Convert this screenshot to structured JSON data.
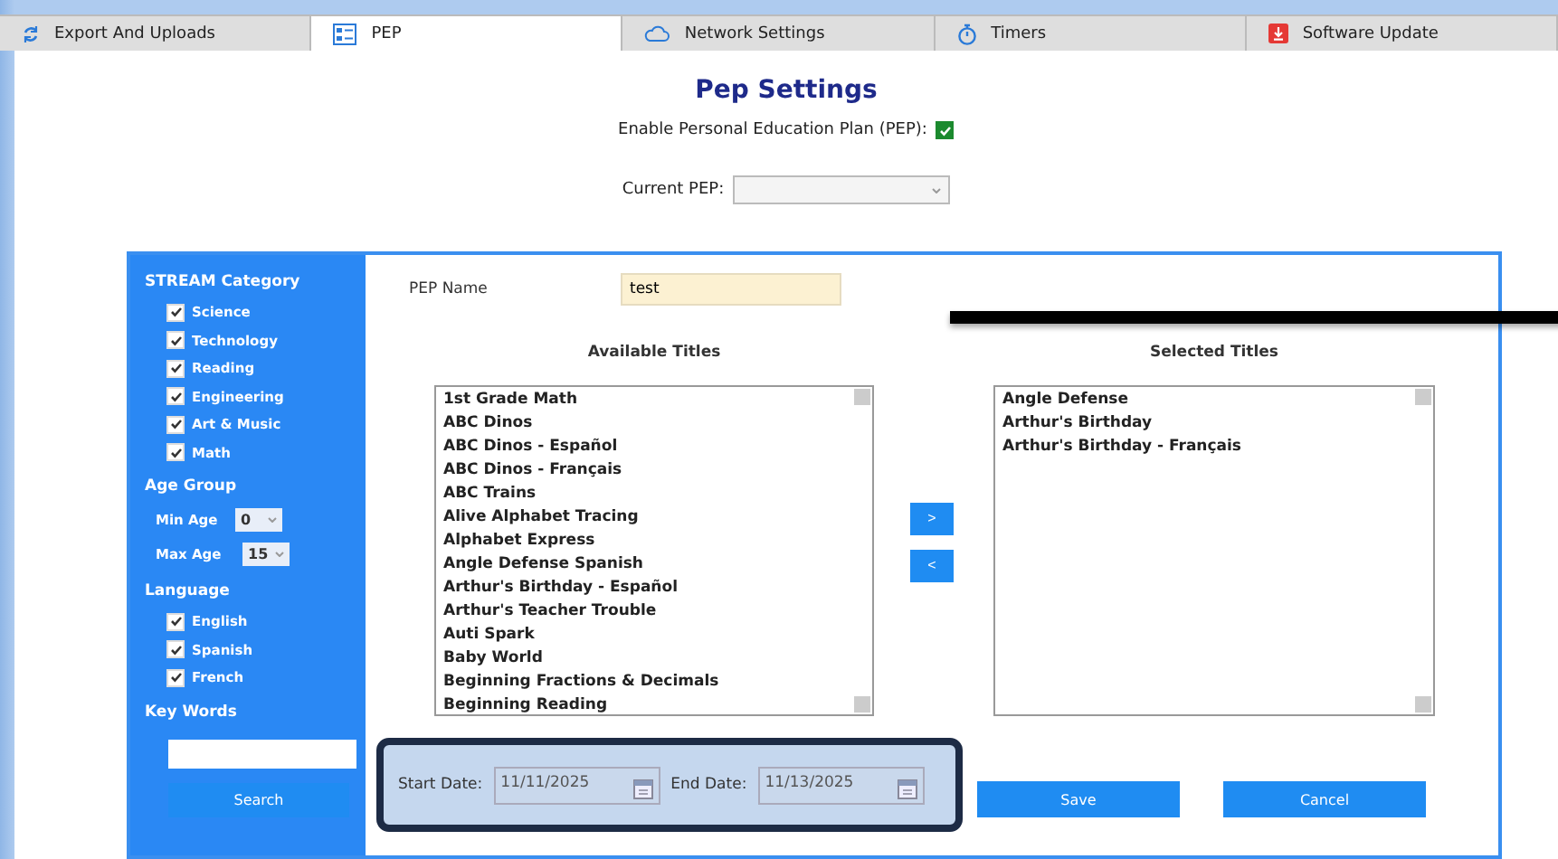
{
  "tabs": [
    {
      "label": "Export And Uploads",
      "selected": false
    },
    {
      "label": "PEP",
      "selected": true
    },
    {
      "label": "Network Settings",
      "selected": false
    },
    {
      "label": "Timers",
      "selected": false
    },
    {
      "label": "Software Update",
      "selected": false
    }
  ],
  "title": "Pep Settings",
  "enable_pep": {
    "label": "Enable Personal Education Plan (PEP):",
    "checked": true
  },
  "current_pep": {
    "label": "Current PEP:"
  },
  "sidebar": {
    "sections": [
      {
        "heading": "STREAM Category",
        "kind": "checks",
        "items": [
          {
            "label": "Science",
            "checked": true
          },
          {
            "label": "Technology",
            "checked": true
          },
          {
            "label": "Reading",
            "checked": true
          },
          {
            "label": "Engineering",
            "checked": true
          },
          {
            "label": "Art & Music",
            "checked": true
          },
          {
            "label": "Math",
            "checked": true
          }
        ]
      },
      {
        "heading": "Age Group",
        "kind": "selects",
        "items": [
          {
            "label": "Min Age",
            "value": "0"
          },
          {
            "label": "Max Age",
            "value": "15"
          }
        ]
      },
      {
        "heading": "Language",
        "kind": "checks",
        "items": [
          {
            "label": "English",
            "checked": true
          },
          {
            "label": "Spanish",
            "checked": true
          },
          {
            "label": "French",
            "checked": true
          }
        ]
      },
      {
        "heading": "Key Words",
        "kind": "input"
      }
    ],
    "search_button": "Search"
  },
  "pep_name": {
    "label": "PEP Name",
    "value": "test"
  },
  "available": {
    "heading": "Available Titles",
    "items": [
      "1st Grade Math",
      "ABC Dinos",
      "ABC Dinos - Español",
      "ABC Dinos - Français",
      "ABC Trains",
      "Alive Alphabet Tracing",
      "Alphabet Express",
      "Angle Defense Spanish",
      "Arthur's Birthday - Español",
      "Arthur's Teacher Trouble",
      "Auti Spark",
      "Baby World",
      "Beginning Fractions & Decimals",
      "Beginning Reading"
    ]
  },
  "move_buttons": [
    ">",
    "<"
  ],
  "selected_titles": {
    "heading": "Selected Titles",
    "items": [
      "Angle Defense",
      "Arthur's Birthday",
      "Arthur's Birthday - Français"
    ]
  },
  "start_date": {
    "label": "Start Date:",
    "value": "11/11/2025"
  },
  "end_date": {
    "label": "End Date:",
    "value": "11/13/2025"
  },
  "buttons": [
    "Save",
    "Cancel"
  ]
}
